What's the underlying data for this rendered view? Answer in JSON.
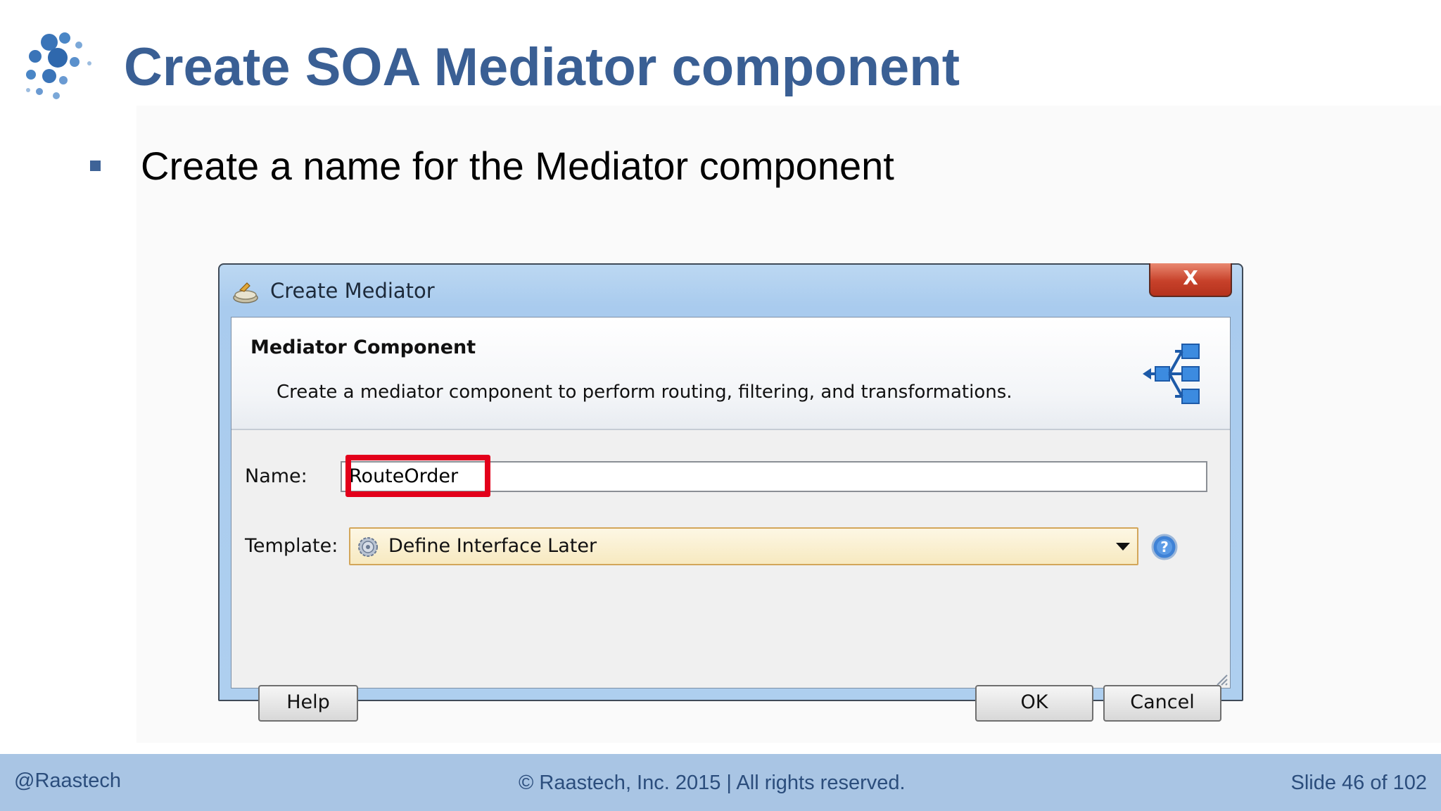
{
  "slide": {
    "title": "Create SOA Mediator component",
    "bullet": "Create a name for the Mediator component"
  },
  "dialog": {
    "title": "Create Mediator",
    "close_label": "X",
    "header": {
      "title": "Mediator Component",
      "description": "Create a mediator component to perform routing, filtering, and transformations."
    },
    "name_label": "Name:",
    "name_value": "RouteOrder",
    "template_label": "Template:",
    "template_value": "Define Interface Later",
    "help_button": "Help",
    "ok_button": "OK",
    "cancel_button": "Cancel"
  },
  "footer": {
    "handle": "@Raastech",
    "copyright": "© Raastech, Inc. 2015  |  All rights reserved.",
    "slide_number": "Slide 46 of 102"
  },
  "colors": {
    "title": "#3a5f94",
    "footer_bg": "#a9c5e4",
    "highlight": "#e3001b"
  },
  "icons": [
    "globe-dots-logo-icon",
    "mediator-title-icon",
    "mediator-routing-icon",
    "gear-icon",
    "help-icon",
    "chevron-down-icon"
  ]
}
